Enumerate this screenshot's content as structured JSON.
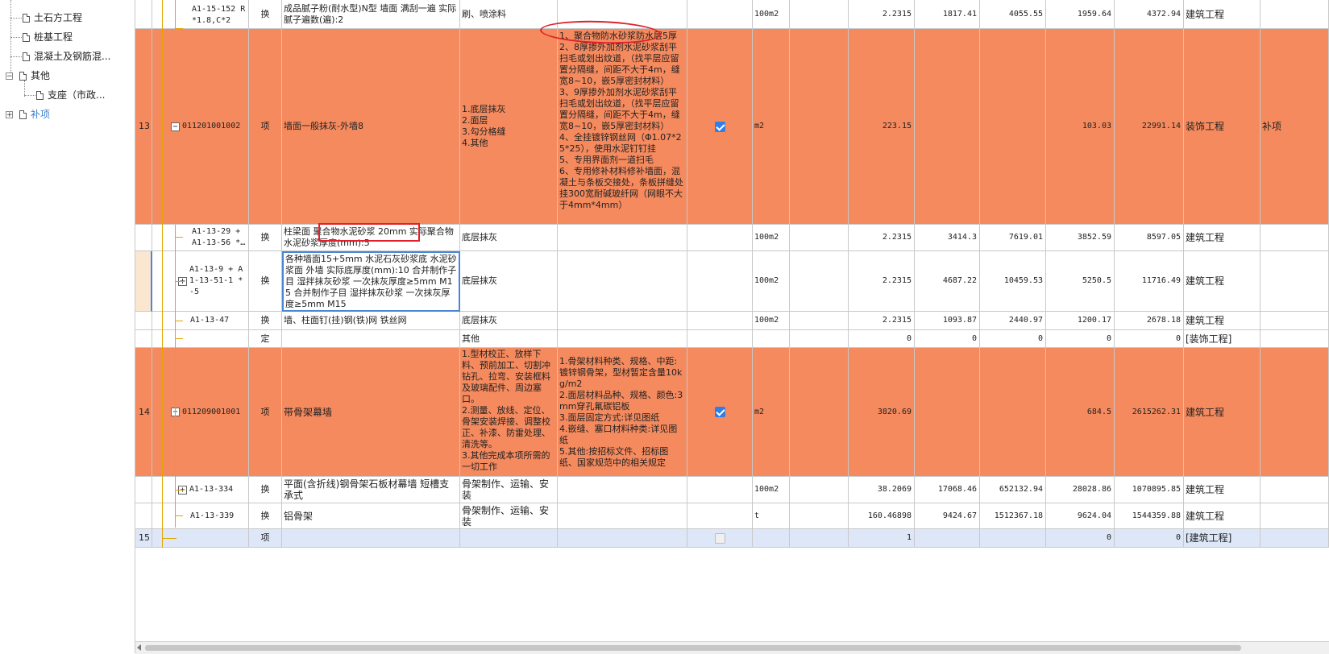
{
  "sidebar": {
    "items": [
      {
        "label": "土石方工程"
      },
      {
        "label": "桩基工程"
      },
      {
        "label": "混凝土及钢筋混..."
      },
      {
        "label": "其他"
      },
      {
        "label": "支座（市政..."
      },
      {
        "label": "补项"
      }
    ]
  },
  "rows": {
    "r1": {
      "code": "A1-15-152 R*1.8,C*2",
      "type": "换",
      "name": "成品腻子粉(耐水型)N型 墙面 满刮一遍 实际腻子遍数(遍):2",
      "feature": "刷、喷涂料",
      "unit": "100m2",
      "qty": "2.2315",
      "c1": "1817.41",
      "c2": "4055.55",
      "c3": "1959.64",
      "c4": "4372.94",
      "cat": "建筑工程"
    },
    "r13": {
      "seq": "13",
      "code": "011201001002",
      "type": "项",
      "name": "墙面一般抹灰-外墙8",
      "feature": "1.底层抹灰\n2.面层\n3.勾分格缝\n4.其他",
      "content": "1、聚合物防水砂浆防水层5厚\n2、8厚掺外加剂水泥砂浆刮平扫毛或划出纹道，（找平层应留置分隔缝，间距不大于4m，缝宽8~10，嵌5厚密封材料）\n3、9厚掺外加剂水泥砂浆刮平扫毛或划出纹道，（找平层应留置分隔缝，间距不大于4m，缝宽8~10，嵌5厚密封材料）\n4、全挂镀锌钢丝网（Φ1.07*25*25），使用水泥钉钉挂\n5、专用界面剂一道扫毛\n6、专用修补材料修补墙面，混凝土与条板交接处，条板拼缝处挂300宽耐碱玻纤网（网眼不大于4mm*4mm）",
      "unit": "m2",
      "qty": "223.15",
      "c3": "103.03",
      "c4": "22991.14",
      "cat": "装饰工程",
      "extra": "补项"
    },
    "r2": {
      "code": "A1-13-29 + A1-13-56 *…",
      "type": "换",
      "name": "柱梁面 聚合物水泥砂浆 20mm 实际聚合物水泥砂浆厚度(mm):5",
      "feature": "底层抹灰",
      "unit": "100m2",
      "qty": "2.2315",
      "c1": "3414.3",
      "c2": "7619.01",
      "c3": "3852.59",
      "c4": "8597.05",
      "cat": "建筑工程"
    },
    "r3": {
      "code": "A1-13-9 + A1-13-51-1 * -5",
      "type": "换",
      "name": "各种墙面15+5mm 水泥石灰砂浆底 水泥砂浆面 外墙 实际底厚度(mm):10 合并制作子目 湿拌抹灰砂浆 一次抹灰厚度≥5mm M15 合并制作子目 湿拌抹灰砂浆 一次抹灰厚度≥5mm M15",
      "feature": "底层抹灰",
      "unit": "100m2",
      "qty": "2.2315",
      "c1": "4687.22",
      "c2": "10459.53",
      "c3": "5250.5",
      "c4": "11716.49",
      "cat": "建筑工程"
    },
    "r4": {
      "code": "A1-13-47",
      "type": "换",
      "name": "墙、柱面钉(挂)钢(铁)网 铁丝网",
      "feature": "底层抹灰",
      "unit": "100m2",
      "qty": "2.2315",
      "c1": "1093.87",
      "c2": "2440.97",
      "c3": "1200.17",
      "c4": "2678.18",
      "cat": "建筑工程"
    },
    "r5": {
      "type": "定",
      "feature": "其他",
      "qty": "0",
      "c1": "0",
      "c2": "0",
      "c3": "0",
      "c4": "0",
      "cat": "[装饰工程]"
    },
    "r14": {
      "seq": "14",
      "code": "011209001001",
      "type": "项",
      "name": "带骨架幕墙",
      "feature": "1.型材校正、放样下料、预前加工、切割冲钻孔、拉弯、安装框料及玻璃配件、周边塞口。\n2.测量、放线、定位、骨架安装焊接、调整校正、补漆、防雷处理、清洗等。\n3.其他完成本项所需的一切工作",
      "content": "1.骨架材料种类、规格、中距:镀锌钢骨架，型材暂定含量10kg/m2\n2.面层材料品种、规格、颜色:3mm穿孔氟碳铝板\n3.面层固定方式:详见图纸\n4.嵌缝、塞口材料种类:详见图纸\n5.其他:按招标文件、招标图纸、国家规范中的相关规定",
      "unit": "m2",
      "qty": "3820.69",
      "c3": "684.5",
      "c4": "2615262.31",
      "cat": "建筑工程"
    },
    "r6": {
      "code": "A1-13-334",
      "type": "换",
      "name": "平面(含折线)钢骨架石板材幕墙 短槽支承式",
      "feature": "骨架制作、运输、安装",
      "unit": "100m2",
      "qty": "38.2069",
      "c1": "17068.46",
      "c2": "652132.94",
      "c3": "28028.86",
      "c4": "1070895.85",
      "cat": "建筑工程"
    },
    "r7": {
      "code": "A1-13-339",
      "type": "换",
      "name": "铝骨架",
      "feature": "骨架制作、运输、安装",
      "unit": "t",
      "qty": "160.46898",
      "c1": "9424.67",
      "c2": "1512367.18",
      "c3": "9624.04",
      "c4": "1544359.88",
      "cat": "建筑工程"
    },
    "r15": {
      "seq": "15",
      "type": "项",
      "qty": "1",
      "c3": "0",
      "c4": "0",
      "cat": "[建筑工程]"
    }
  },
  "colors": {
    "orange_row": "#f58a5e",
    "selected_row": "#dde7f7",
    "checkbox": "#2f7fe6",
    "highlight": "#e0202a"
  }
}
